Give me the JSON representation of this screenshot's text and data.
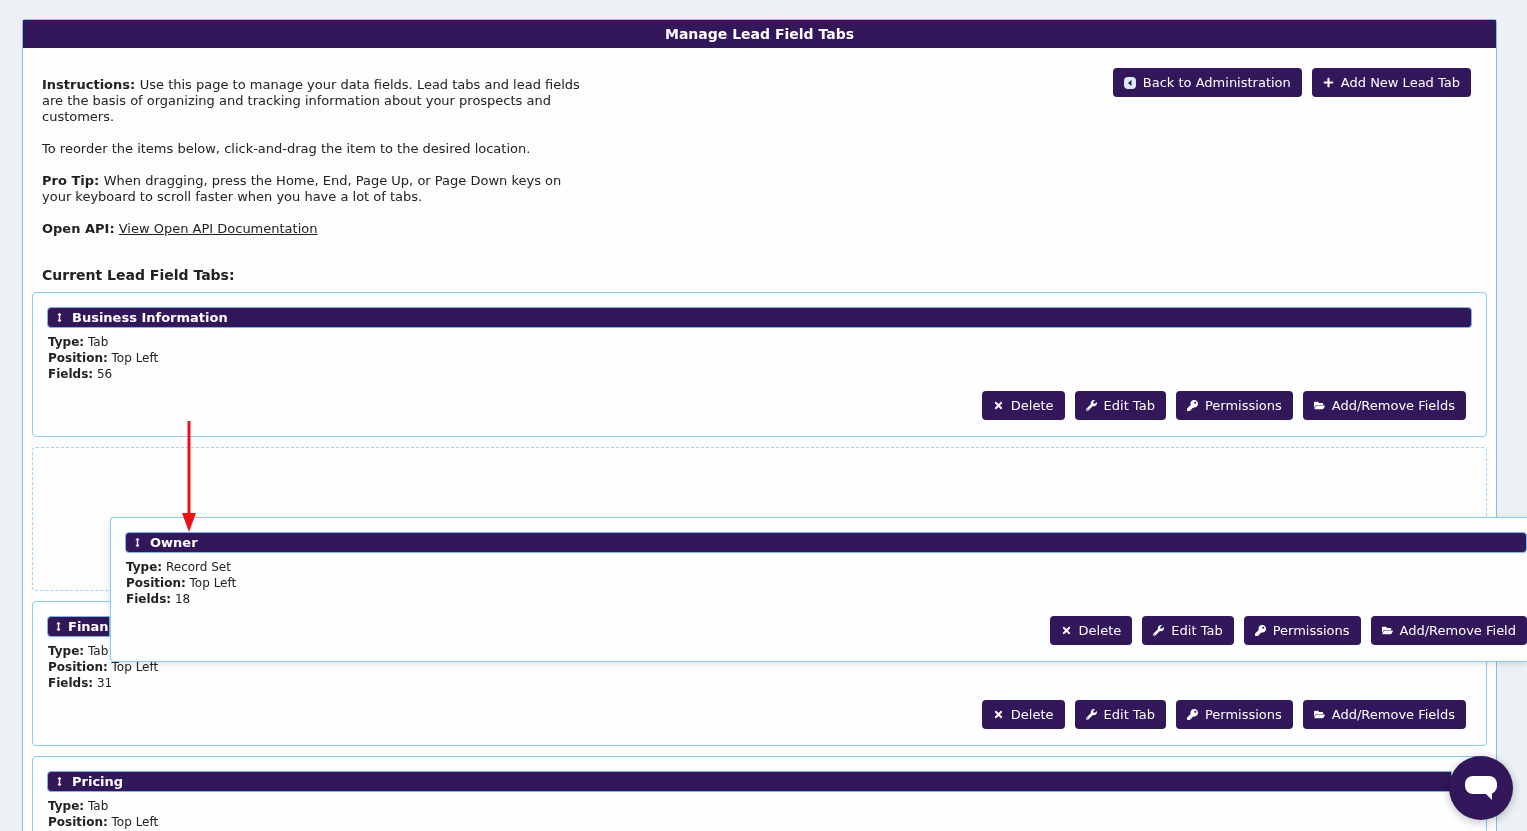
{
  "title": "Manage Lead Field Tabs",
  "instructions": [
    {
      "label": "Instructions:",
      "text": "Use this page to manage your data fields. Lead tabs and lead fields are the basis of organizing and tracking information about your prospects and customers."
    },
    {
      "text": "To reorder the items below, click-and-drag the item to the desired location."
    },
    {
      "label": "Pro Tip:",
      "text": "When dragging, press the Home, End, Page Up, or Page Down keys on your keyboard to scroll faster when you have a lot of tabs."
    }
  ],
  "api": {
    "label": "Open API:",
    "link": "View Open API Documentation"
  },
  "header_buttons": [
    {
      "kind": "back",
      "label": "Back to Administration"
    },
    {
      "kind": "add",
      "label": "Add New Lead Tab"
    }
  ],
  "section_heading": "Current Lead Field Tabs:",
  "tabs": [
    {
      "kind": "card",
      "title": "Business Information",
      "details": [
        {
          "label": "Type:",
          "value": "Tab"
        },
        {
          "label": "Position:",
          "value": "Top Left"
        },
        {
          "label": "Fields:",
          "value": "56"
        }
      ],
      "buttons": [
        {
          "kind": "delete",
          "label": "Delete"
        },
        {
          "kind": "edit",
          "label": "Edit Tab"
        },
        {
          "kind": "permissions",
          "label": "Permissions"
        },
        {
          "kind": "fields",
          "label": "Add/Remove Fields"
        }
      ]
    },
    {
      "kind": "drop_placeholder"
    },
    {
      "kind": "card",
      "title": "Finan",
      "details": [
        {
          "label": "Type:",
          "value": "Tab"
        },
        {
          "label": "Position:",
          "value": "Top Left"
        },
        {
          "label": "Fields:",
          "value": "31"
        }
      ],
      "buttons": [
        {
          "kind": "delete",
          "label": "Delete"
        },
        {
          "kind": "edit",
          "label": "Edit Tab"
        },
        {
          "kind": "permissions",
          "label": "Permissions"
        },
        {
          "kind": "fields",
          "label": "Add/Remove Fields"
        }
      ]
    },
    {
      "kind": "card",
      "title": "Pricing",
      "details": [
        {
          "label": "Type:",
          "value": "Tab"
        },
        {
          "label": "Position:",
          "value": "Top Left"
        }
      ]
    }
  ],
  "dragged_tab": {
    "title": "Owner",
    "details": [
      {
        "label": "Type:",
        "value": "Record Set"
      },
      {
        "label": "Position:",
        "value": "Top Left"
      },
      {
        "label": "Fields:",
        "value": "18"
      }
    ],
    "buttons": [
      {
        "kind": "delete",
        "label": "Delete"
      },
      {
        "kind": "edit",
        "label": "Edit Tab"
      },
      {
        "kind": "permissions",
        "label": "Permissions"
      },
      {
        "kind": "fields",
        "label": "Add/Remove Field"
      }
    ]
  }
}
